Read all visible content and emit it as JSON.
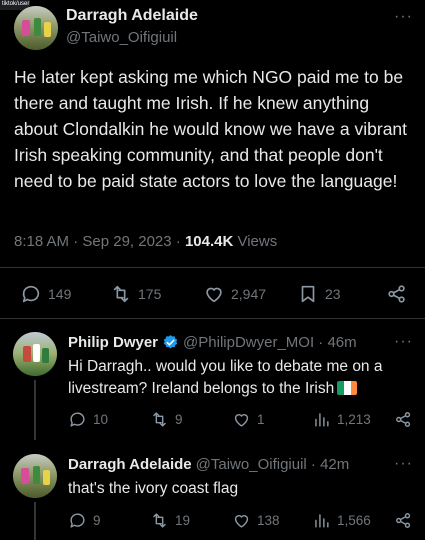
{
  "corner_badge": "tiktok/user",
  "main_tweet": {
    "name": "Darragh Adelaide",
    "handle": "@Taiwo_Oifigiuil",
    "more": "···",
    "text": "He later kept asking me which NGO paid me to be there and taught me Irish. If he knew anything about Clondalkin he would know we have a vibrant Irish speaking community, and that people don't need to be paid state actors to love the language!",
    "time": "8:18 AM · Sep 29, 2023 · ",
    "views_count": "104.4K",
    "views_label": " Views",
    "stats": {
      "replies": "149",
      "retweets": "175",
      "likes": "2,947",
      "bookmarks": "23"
    }
  },
  "replies": [
    {
      "name": "Philip Dwyer",
      "handle": "@PhilipDwyer_MOI · 46m",
      "verified": true,
      "text": "Hi Darragh.. would you like to debate me on a livestream? Ireland belongs to the Irish",
      "flag_colors": [
        "#169b62",
        "#ffffff",
        "#ff883e"
      ],
      "stats": {
        "replies": "10",
        "retweets": "9",
        "likes": "1",
        "views": "1,213"
      }
    },
    {
      "name": "Darragh Adelaide",
      "handle": "@Taiwo_Oifigiuil · 42m",
      "text": "that's the ivory coast flag",
      "stats": {
        "replies": "9",
        "retweets": "19",
        "likes": "138",
        "views": "1,566"
      }
    }
  ],
  "colors": {
    "background": "#000000",
    "text": "#e7e9ea",
    "muted": "#71767b",
    "verified": "#1d9bf0"
  }
}
